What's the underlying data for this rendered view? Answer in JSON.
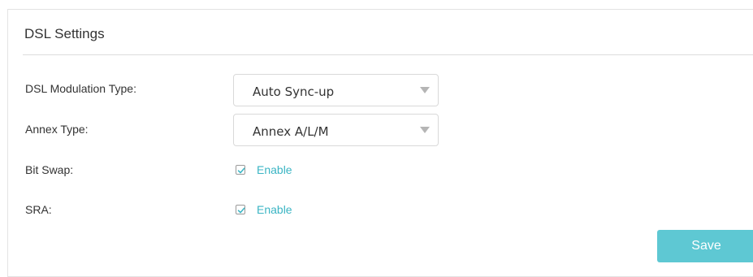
{
  "section": {
    "title": "DSL Settings"
  },
  "fields": {
    "modulation": {
      "label": "DSL Modulation Type:",
      "value": "Auto Sync-up"
    },
    "annex": {
      "label": "Annex Type:",
      "value": "Annex A/L/M"
    },
    "bit_swap": {
      "label": "Bit Swap:",
      "checkbox_label": "Enable",
      "checked": true
    },
    "sra": {
      "label": "SRA:",
      "checkbox_label": "Enable",
      "checked": true
    }
  },
  "actions": {
    "save_label": "Save"
  },
  "colors": {
    "accent": "#3bb5c4",
    "button": "#5ec8d3",
    "text": "#333333"
  },
  "icons": {
    "dropdown": "chevron-down-icon",
    "check": "checkmark-icon"
  }
}
